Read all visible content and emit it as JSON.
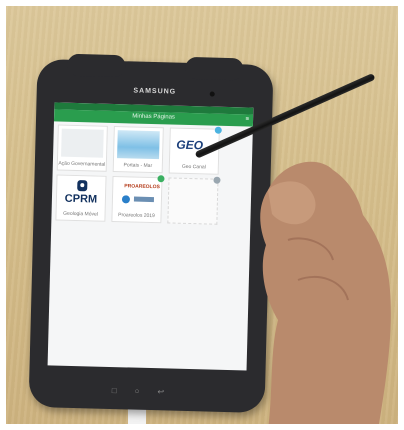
{
  "device": {
    "brand": "SAMSUNG"
  },
  "app": {
    "title": "Minhas Páginas",
    "tiles": [
      {
        "label": "Ação Governamental",
        "icon": "placeholder-image-icon",
        "badge": ""
      },
      {
        "label": "Portais - Mar",
        "icon": "water-image-icon",
        "badge": ""
      },
      {
        "label": "Geo Canal",
        "icon": "geo-logo-icon",
        "badge": "blue"
      },
      {
        "label": "Geologia Móvel",
        "icon": "cprm-logo-icon",
        "badge": "",
        "logo_text": "CPRM"
      },
      {
        "label": "Proareolos 2019",
        "icon": "proareas-logo-icon",
        "badge": "green",
        "logo_text": "PROAREOLOS"
      },
      {
        "label": "",
        "icon": "empty-tile",
        "badge": "grey"
      }
    ]
  },
  "colors": {
    "appbar": "#2a9d4e",
    "statusbar": "#1e7a3c",
    "tablet": "#2b2b2e"
  }
}
